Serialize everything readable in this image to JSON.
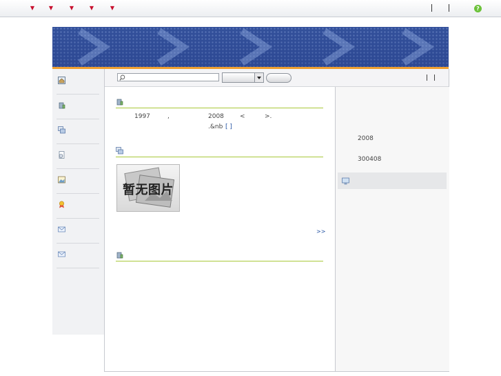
{
  "nav": {
    "dropdown_markers": [
      "▼",
      "▼",
      "▼",
      "▼",
      "▼"
    ],
    "help_glyph": "?"
  },
  "search": {
    "placeholder": "",
    "value": "",
    "select_value": "",
    "button_label": ""
  },
  "sidebar": {
    "icons": [
      "home-icon",
      "building-icon",
      "windows-icon",
      "document-icon",
      "picture-icon",
      "award-icon",
      "mail-icon",
      "mail-icon"
    ]
  },
  "intro": {
    "year1": "1997",
    "comma": ",",
    "year2": "2008",
    "lt": "<",
    "gt": ">.",
    "nbsp_text": ".&nb",
    "more_bracket": "[ ]"
  },
  "photo": {
    "placeholder_text": "暂无图片"
  },
  "more_link": ">>",
  "right": {
    "year": "2008",
    "code": "300408"
  },
  "colors": {
    "banner_blue": "#33509a",
    "banner_strip": "#f0a030",
    "section_rule": "#a8c838",
    "nav_marker": "#c8102e",
    "link": "#1f4fa0"
  }
}
